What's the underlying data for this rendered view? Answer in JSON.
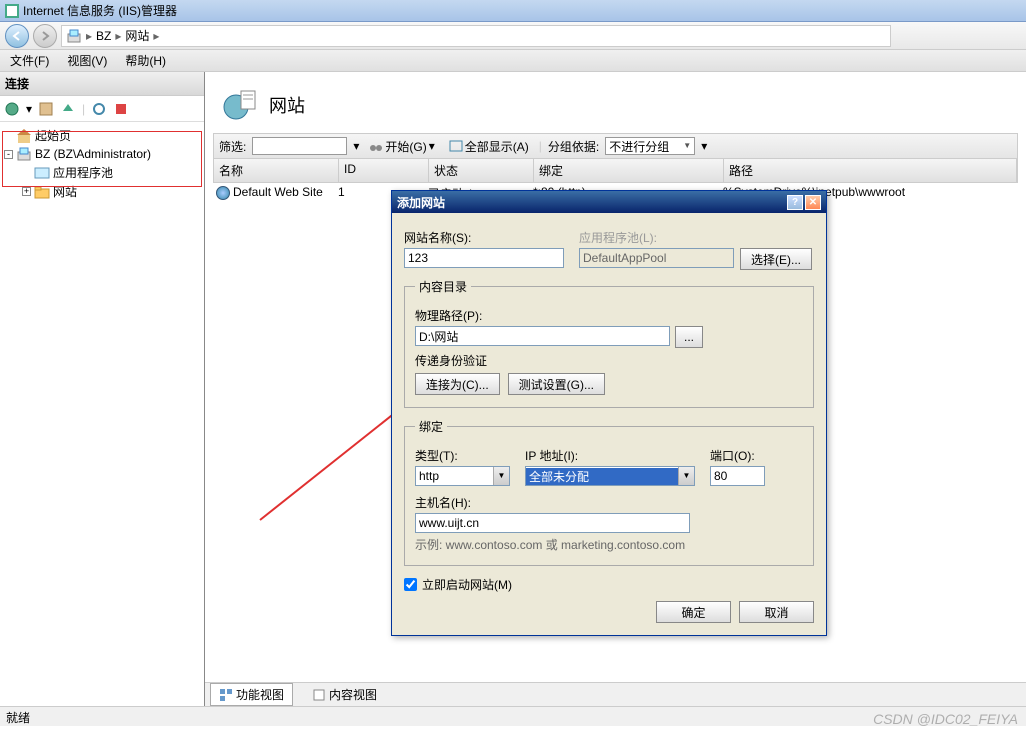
{
  "window": {
    "title": "Internet 信息服务 (IIS)管理器"
  },
  "breadcrumb": {
    "node1": "BZ",
    "node2": "网站"
  },
  "menu": {
    "file": "文件(F)",
    "view": "视图(V)",
    "help": "帮助(H)"
  },
  "left": {
    "header": "连接",
    "tree": {
      "start": "起始页",
      "server": "BZ (BZ\\Administrator)",
      "apppool": "应用程序池",
      "sites": "网站"
    }
  },
  "page": {
    "title": "网站"
  },
  "filter": {
    "label": "筛选:",
    "go": "开始(G)",
    "showall": "全部显示(A)",
    "groupby": "分组依据:",
    "groupval": "不进行分组"
  },
  "grid": {
    "hName": "名称",
    "hId": "ID",
    "hStatus": "状态",
    "hBinding": "绑定",
    "hPath": "路径",
    "rName": "Default Web Site",
    "rId": "1",
    "rStatus": "已启动 (...",
    "rBinding": "*:80 (http)",
    "rPath": "%SystemDrive%\\inetpub\\wwwroot"
  },
  "tabs": {
    "features": "功能视图",
    "content": "内容视图"
  },
  "status": "就绪",
  "watermark": "CSDN @IDC02_FEIYA",
  "dlg": {
    "title": "添加网站",
    "siteNameL": "网站名称(S):",
    "siteName": "123",
    "appPoolL": "应用程序池(L):",
    "appPool": "DefaultAppPool",
    "selectBtn": "选择(E)...",
    "contentDir": "内容目录",
    "physPathL": "物理路径(P):",
    "physPath": "D:\\网站",
    "passAuth": "传递身份验证",
    "connectAs": "连接为(C)...",
    "testSettings": "测试设置(G)...",
    "binding": "绑定",
    "typeL": "类型(T):",
    "typeV": "http",
    "ipL": "IP 地址(I):",
    "ipV": "全部未分配",
    "portL": "端口(O):",
    "portV": "80",
    "hostL": "主机名(H):",
    "hostV": "www.uijt.cn",
    "example": "示例: www.contoso.com 或 marketing.contoso.com",
    "startNow": "立即启动网站(M)",
    "ok": "确定",
    "cancel": "取消"
  }
}
